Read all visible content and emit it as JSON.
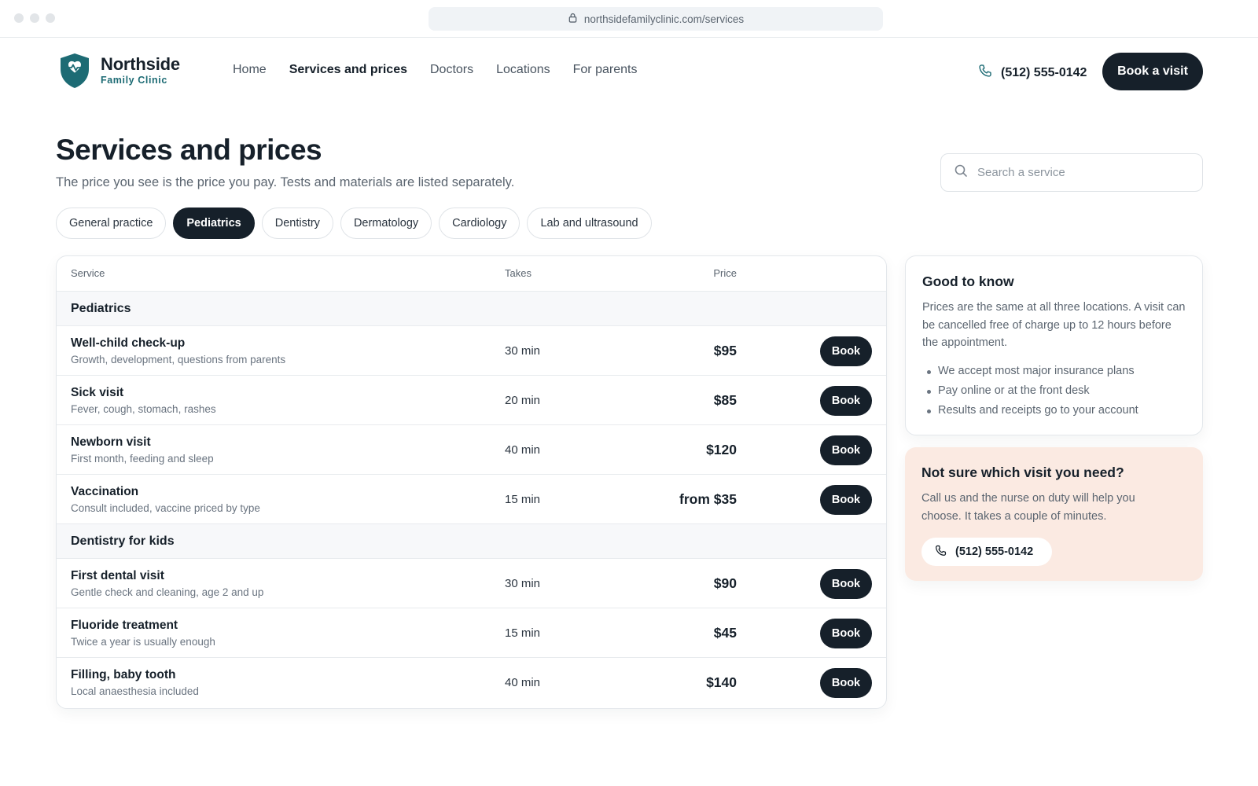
{
  "browser": {
    "url": "northsidefamilyclinic.com/services"
  },
  "brand": {
    "name": "Northside",
    "subtitle": "Family Clinic"
  },
  "nav": {
    "items": [
      {
        "label": "Home",
        "active": false
      },
      {
        "label": "Services and prices",
        "active": true
      },
      {
        "label": "Doctors",
        "active": false
      },
      {
        "label": "Locations",
        "active": false
      },
      {
        "label": "For parents",
        "active": false
      }
    ],
    "phone": "(512) 555-0142",
    "book_label": "Book a visit"
  },
  "page": {
    "title": "Services and prices",
    "subtitle": "The price you see is the price you pay. Tests and materials are listed separately."
  },
  "search": {
    "placeholder": "Search a service"
  },
  "categories": [
    {
      "label": "General practice",
      "active": false
    },
    {
      "label": "Pediatrics",
      "active": true
    },
    {
      "label": "Dentistry",
      "active": false
    },
    {
      "label": "Dermatology",
      "active": false
    },
    {
      "label": "Cardiology",
      "active": false
    },
    {
      "label": "Lab and ultrasound",
      "active": false
    }
  ],
  "table": {
    "columns": {
      "service": "Service",
      "takes": "Takes",
      "price": "Price"
    },
    "book_label": "Book",
    "groups": [
      {
        "name": "Pediatrics",
        "rows": [
          {
            "name": "Well-child check-up",
            "desc": "Growth, development, questions from parents",
            "takes": "30 min",
            "price": "$95"
          },
          {
            "name": "Sick visit",
            "desc": "Fever, cough, stomach, rashes",
            "takes": "20 min",
            "price": "$85"
          },
          {
            "name": "Newborn visit",
            "desc": "First month, feeding and sleep",
            "takes": "40 min",
            "price": "$120"
          },
          {
            "name": "Vaccination",
            "desc": "Consult included, vaccine priced by type",
            "takes": "15 min",
            "price": "from $35"
          }
        ]
      },
      {
        "name": "Dentistry for kids",
        "rows": [
          {
            "name": "First dental visit",
            "desc": "Gentle check and cleaning, age 2 and up",
            "takes": "30 min",
            "price": "$90"
          },
          {
            "name": "Fluoride treatment",
            "desc": "Twice a year is usually enough",
            "takes": "15 min",
            "price": "$45"
          },
          {
            "name": "Filling, baby tooth",
            "desc": "Local anaesthesia included",
            "takes": "40 min",
            "price": "$140"
          }
        ]
      }
    ]
  },
  "info": {
    "title": "Good to know",
    "text": "Prices are the same at all three locations. A visit can be cancelled free of charge up to 12 hours before the appointment.",
    "bullets": [
      "We accept most major insurance plans",
      "Pay online or at the front desk",
      "Results and receipts go to your account"
    ]
  },
  "help": {
    "title": "Not sure which visit you need?",
    "text": "Call us and the nurse on duty will help you choose. It takes a couple of minutes.",
    "phone": "(512) 555-0142"
  },
  "colors": {
    "primary": "#16202a",
    "brand_teal": "#1d6b74",
    "help_bg": "#fbeae2"
  },
  "icons": {
    "lock": "lock-icon",
    "phone": "phone-icon",
    "search": "search-icon",
    "logo": "shield-heart-icon"
  }
}
